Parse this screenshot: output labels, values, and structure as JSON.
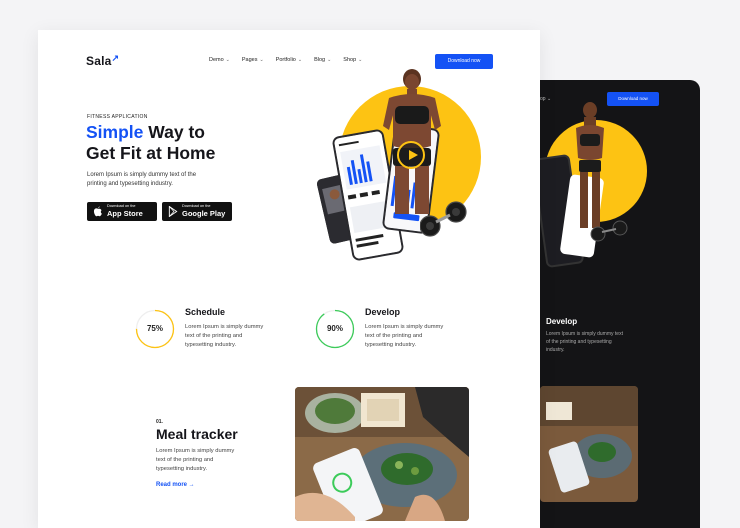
{
  "brand": {
    "name": "Sala",
    "arrow": "↗"
  },
  "nav": {
    "items": [
      {
        "label": "Demo"
      },
      {
        "label": "Pages"
      },
      {
        "label": "Portfolio"
      },
      {
        "label": "Blog"
      },
      {
        "label": "Shop"
      }
    ],
    "chevron": "⌄",
    "download_label": "Download now"
  },
  "hero": {
    "eyebrow": "FITNESS APPLICATION",
    "title_accent": "Simple",
    "title_rest_line1": " Way to",
    "title_line2": "Get Fit at Home",
    "description": "Lorem Ipsum is simply dummy text of the printing and typesetting industry.",
    "app_store": {
      "small": "Download on the",
      "big": "App Store"
    },
    "google_play": {
      "small": "Download on the",
      "big": "Google Play"
    }
  },
  "stats": [
    {
      "percent": "75%",
      "value": 0.75,
      "color": "#fdc313",
      "title": "Schedule",
      "text": "Lorem Ipsum is simply dummy text of the printing and typesetting industry."
    },
    {
      "percent": "90%",
      "value": 0.9,
      "color": "#3ccb5a",
      "title": "Develop",
      "text": "Lorem Ipsum is simply dummy text of the printing and typesetting industry."
    }
  ],
  "meal": {
    "number": "01.",
    "title": "Meal tracker",
    "text": "Lorem Ipsum is simply dummy text of the printing and typesetting industry.",
    "read_more": "Read more →"
  },
  "dark_preview": {
    "nav_fragment": "op ⌄",
    "download_label": "Download now",
    "title": "Develop",
    "text": "Lorem Ipsum is simply dummy text of the printing and typesetting industry."
  },
  "colors": {
    "accent": "#1452f5",
    "yellow": "#fdc313",
    "green": "#3ccb5a",
    "dark": "#141416"
  }
}
